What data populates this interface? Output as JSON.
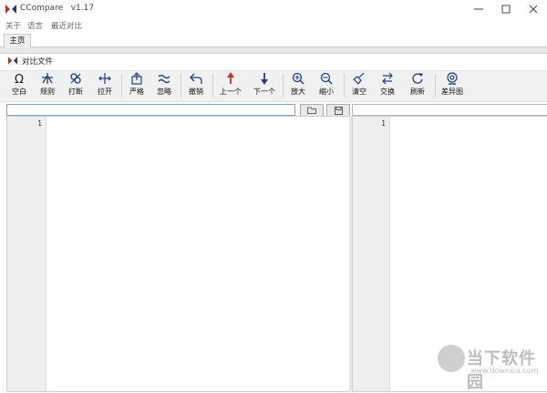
{
  "window": {
    "title": "CCompare   v1.17"
  },
  "menu": {
    "items": [
      "关于",
      "语言",
      "最近对比"
    ]
  },
  "tabs": {
    "home": "主页"
  },
  "document": {
    "title": "对比文件"
  },
  "toolbar": {
    "buttons": [
      {
        "label": "空白",
        "icon": "omega-icon"
      },
      {
        "label": "规则",
        "icon": "rule-icon"
      },
      {
        "label": "打断",
        "icon": "break-icon"
      },
      {
        "label": "拉开",
        "icon": "expand-icon"
      },
      {
        "label": "严格",
        "icon": "strict-icon"
      },
      {
        "label": "忽略",
        "icon": "ignore-icon"
      },
      {
        "label": "撤销",
        "icon": "undo-icon"
      },
      {
        "label": "上一个",
        "icon": "up-arrow-icon"
      },
      {
        "label": "下一个",
        "icon": "down-arrow-icon"
      },
      {
        "label": "放大",
        "icon": "zoom-in-icon"
      },
      {
        "label": "缩小",
        "icon": "zoom-out-icon"
      },
      {
        "label": "清空",
        "icon": "clear-icon"
      },
      {
        "label": "交换",
        "icon": "swap-icon"
      },
      {
        "label": "刷新",
        "icon": "refresh-icon"
      },
      {
        "label": "差异图",
        "icon": "diff-map-icon"
      }
    ]
  },
  "left": {
    "path_value": "",
    "line_number": "1"
  },
  "right": {
    "path_value": "",
    "line_number": "1"
  },
  "watermark": {
    "text": "当下软件园",
    "url": "www.downxia.com"
  },
  "colors": {
    "accent_red": "#c62828",
    "accent_blue": "#1a3f8f",
    "up_arrow": "#d32f2f",
    "down_arrow": "#1f3e84"
  }
}
